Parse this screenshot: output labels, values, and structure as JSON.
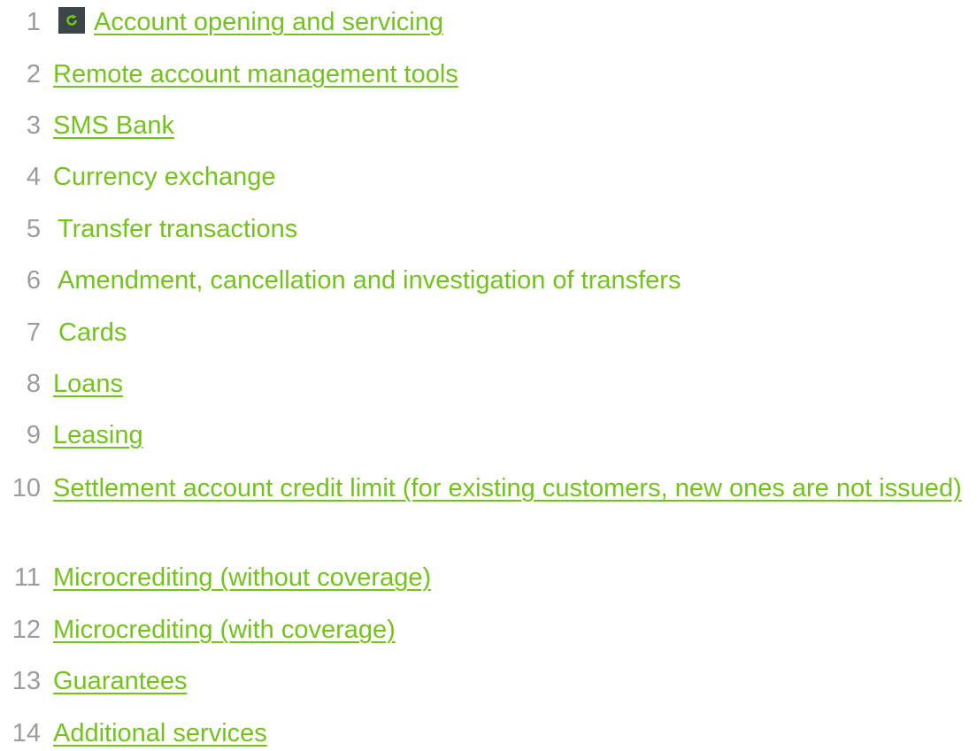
{
  "items": [
    {
      "number": "1",
      "label": "Account opening and servicing",
      "link": true,
      "icon": "refresh-icon"
    },
    {
      "number": "2",
      "label": "Remote account management tools",
      "link": true
    },
    {
      "number": "3",
      "label": "SMS Bank",
      "link": true
    },
    {
      "number": "4",
      "label": "Currency exchange",
      "link": false
    },
    {
      "number": "5",
      "label": "Transfer transactions",
      "link": false
    },
    {
      "number": "6",
      "label": "Amendment, cancellation and investigation of transfers",
      "link": false
    },
    {
      "number": "7",
      "label": "Cards",
      "link": false
    },
    {
      "number": "8",
      "label": "Loans",
      "link": true
    },
    {
      "number": "9",
      "label": "Leasing",
      "link": true
    },
    {
      "number": "10",
      "label": "Settlement account credit limit (for existing customers, new ones are not issued)",
      "link": true
    },
    {
      "number": "11",
      "label": "Microcrediting (without coverage)",
      "link": true
    },
    {
      "number": "12",
      "label": "Microcrediting (with coverage)",
      "link": true
    },
    {
      "number": "13",
      "label": "Guarantees",
      "link": true
    },
    {
      "number": "14",
      "label": "Additional services",
      "link": true
    }
  ],
  "colors": {
    "accent": "#73c31c",
    "number": "#9c9c9c",
    "icon_bg": "#3c4548"
  }
}
